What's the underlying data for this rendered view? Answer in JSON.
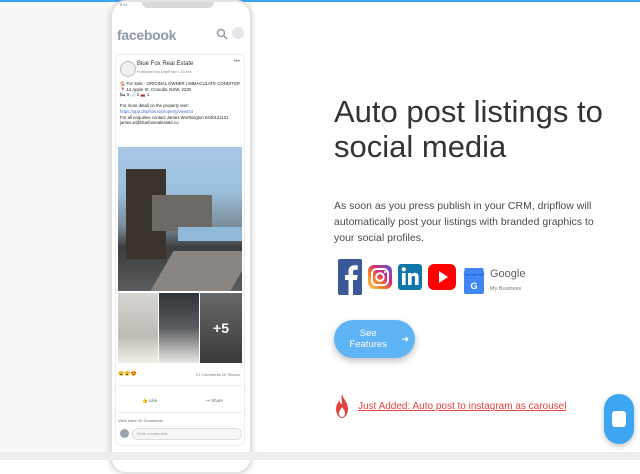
{
  "phone": {
    "status_time": "9:41",
    "app_logo": "facebook",
    "post": {
      "page_name": "Blue Fox Real Estate",
      "published_by": "Published by DripFlow • 10 hrs",
      "lines": [
        "🏠 For Sale - ORIGINAL OWNER | IMMACULATE CONDITION",
        "📍 12 Apple St, Cronulla, NSW, 2230",
        "🛏 3 🛁 2 🚗 1",
        "",
        "For more detail on the property visit:",
        "https://app.dripflow.io/property/view/24",
        "For all enquiries contact James Worthington 0440121121",
        "james.w@bluefoxrealestate.co"
      ],
      "more_photos": "+5",
      "reactions": "😀😮😍",
      "comments_shares": "21 Comments 10 Shares",
      "like_label": "Like",
      "share_label": "Share",
      "view_more": "View more 10 Comments",
      "comment_placeholder": "Write a comment..."
    }
  },
  "hero": {
    "headline": "Auto post listings to social media",
    "description": "As soon as you press publish in your CRM, dripflow will automatically post your listings with branded graphics to your social profiles."
  },
  "socials": [
    {
      "icon": "facebook-icon",
      "color": "#3b5998"
    },
    {
      "icon": "instagram-icon",
      "color": "#c13584"
    },
    {
      "icon": "linkedin-icon",
      "color": "#0e76a8"
    },
    {
      "icon": "youtube-icon",
      "color": "#ff0000"
    },
    {
      "icon": "google-my-business-icon",
      "color": "#4285f4"
    }
  ],
  "google_label": "Google",
  "google_sub": "My Business",
  "features_button": "See Features",
  "notice_link": "Just Added: Auto post to instagram as carousel",
  "accent": "#3da6f2"
}
